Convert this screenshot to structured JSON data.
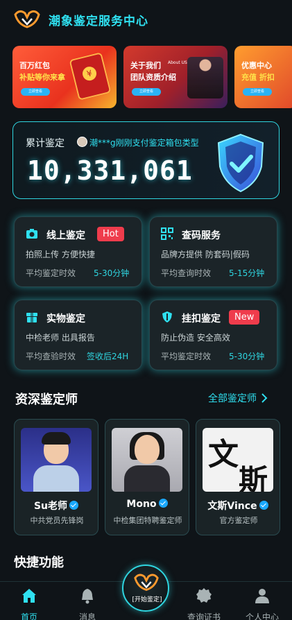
{
  "header": {
    "title": "潮象鉴定服务中心"
  },
  "banners": [
    {
      "line1": "百万红包",
      "line2": "补贴等你来拿",
      "button": "立即查看"
    },
    {
      "line1": "关于我们",
      "line1_en": "About US",
      "line2": "团队资质介绍",
      "button": "立即查看"
    },
    {
      "line1": "优惠中心",
      "line2": "充值 折扣",
      "button": "立即查看"
    }
  ],
  "stats": {
    "label": "累计鉴定",
    "ticker": "潮***g刚刚支付鉴定箱包类型",
    "count": "10,331,061"
  },
  "services": [
    {
      "title": "线上鉴定",
      "badge": "Hot",
      "desc": "拍照上传 方便快捷",
      "meta_label": "平均鉴定时效",
      "meta_value": "5-30分钟"
    },
    {
      "title": "查码服务",
      "desc": "品牌方提供 防套码|假码",
      "meta_label": "平均查询时效",
      "meta_value": "5-15分钟"
    },
    {
      "title": "实物鉴定",
      "desc": "中检老师 出具报告",
      "meta_label": "平均查验时效",
      "meta_value": "签收后24H"
    },
    {
      "title": "挂扣鉴定",
      "badge": "New",
      "desc": "防止伪造 安全高效",
      "meta_label": "平均鉴定时效",
      "meta_value": "5-30分钟"
    }
  ],
  "experts_section": {
    "title": "资深鉴定师",
    "see_all": "全部鉴定师"
  },
  "experts": [
    {
      "name": "Su老师",
      "role": "中共党员先锋岗"
    },
    {
      "name": "Mono",
      "role": "中检集团特聘鉴定师"
    },
    {
      "name": "文斯Vince",
      "role": "官方鉴定师"
    }
  ],
  "calligraphy": {
    "top": "文",
    "bottom": "斯"
  },
  "quick": {
    "title": "快捷功能"
  },
  "tabbar": {
    "home": "首页",
    "messages": "消息",
    "center": "[开始鉴定]",
    "certificates": "查询证书",
    "profile": "个人中心"
  },
  "colors": {
    "accent": "#2fe0f0",
    "badge": "#ef3c4c",
    "background": "#0f1418"
  }
}
